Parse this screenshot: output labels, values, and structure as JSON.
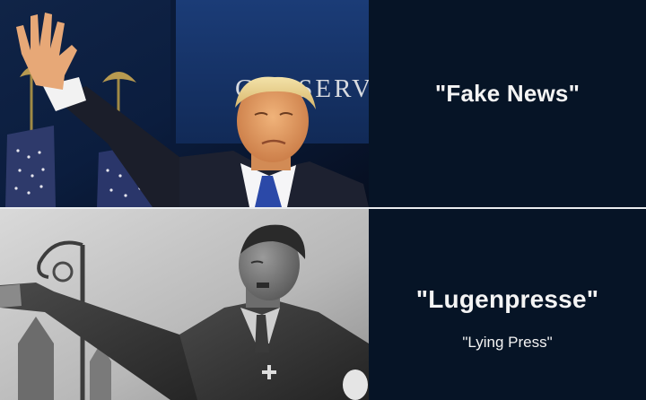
{
  "top_panel": {
    "background_sign_text": "CONSERVA",
    "caption": "\"Fake News\""
  },
  "bottom_panel": {
    "caption": "\"Lugenpresse\"",
    "translation": "\"Lying Press\""
  },
  "colors": {
    "caption_background": "#061426",
    "caption_text": "#f4f4f4",
    "divider": "#e9ecef"
  }
}
